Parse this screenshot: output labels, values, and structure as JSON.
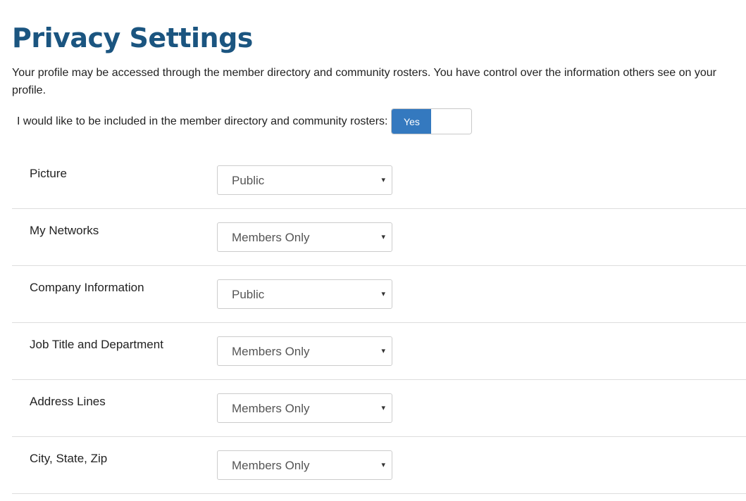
{
  "page": {
    "title": "Privacy Settings",
    "intro": "Your profile may be accessed through the member directory and community rosters. You have control over the information others see on your profile."
  },
  "directory": {
    "label": "I would like to be included in the member directory and community rosters:",
    "toggle_value": "Yes",
    "toggle_on": true,
    "accent_color": "#3479bf"
  },
  "settings": [
    {
      "label": "Picture",
      "value": "Public"
    },
    {
      "label": "My Networks",
      "value": "Members Only"
    },
    {
      "label": "Company Information",
      "value": "Public"
    },
    {
      "label": "Job Title and Department",
      "value": "Members Only"
    },
    {
      "label": "Address Lines",
      "value": "Members Only"
    },
    {
      "label": "City, State, Zip",
      "value": "Members Only"
    }
  ],
  "icons": {
    "dropdown_caret": "caret-down-icon",
    "caret_glyph": "▾"
  },
  "colors": {
    "title": "#1b5580",
    "text": "#222222",
    "divider": "#dddddd"
  }
}
